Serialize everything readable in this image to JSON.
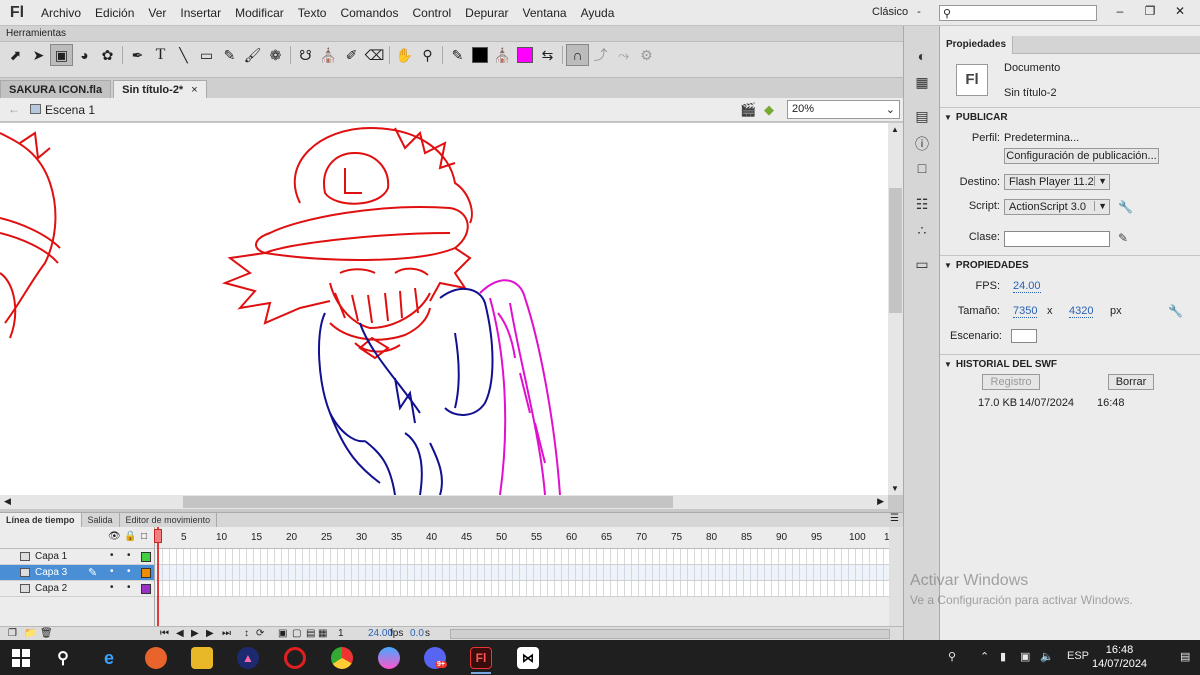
{
  "app": {
    "logo": "Fl"
  },
  "menu": [
    "Archivo",
    "Edición",
    "Ver",
    "Insertar",
    "Modificar",
    "Texto",
    "Comandos",
    "Control",
    "Depurar",
    "Ventana",
    "Ayuda"
  ],
  "workspace": {
    "label": "Clásico",
    "caret": "-"
  },
  "tools_panel": {
    "title": "Herramientas"
  },
  "colors": {
    "stroke": "#000000",
    "fill": "#ff00ff",
    "accent": "#4a8fd6",
    "playhead": "#e23a3a"
  },
  "document_tabs": [
    {
      "label": "SAKURA ICON.fla",
      "close": ""
    },
    {
      "label": "Sin título-2*",
      "close": "×"
    }
  ],
  "scene": {
    "label": "Escena 1",
    "zoom": "20%"
  },
  "timeline": {
    "tabs": [
      "Línea de tiempo",
      "Salida",
      "Editor de movimiento"
    ],
    "ruler": [
      "1",
      "5",
      "10",
      "15",
      "20",
      "25",
      "30",
      "35",
      "40",
      "45",
      "50",
      "55",
      "60",
      "65",
      "70",
      "75",
      "80",
      "85",
      "90",
      "95",
      "100",
      "1"
    ],
    "layers": [
      {
        "name": "Capa 1",
        "color": "#40d040",
        "selected": false
      },
      {
        "name": "Capa 3",
        "color": "#f08c00",
        "selected": true
      },
      {
        "name": "Capa 2",
        "color": "#9b30c8",
        "selected": false
      }
    ],
    "status": {
      "frame": "1",
      "fps": "24.00",
      "fps_unit": "fps",
      "seconds": "0.0",
      "seconds_unit": "s"
    }
  },
  "properties": {
    "tab": "Propiedades",
    "doc_icon": "Fl",
    "doc_type": "Documento",
    "doc_name": "Sin título-2",
    "publish_header": "PUBLICAR",
    "profile_label": "Perfil:",
    "profile_value": "Predetermina...",
    "publish_settings_button": "Configuración de publicación...",
    "target_label": "Destino:",
    "target_value": "Flash Player 11.2",
    "script_label": "Script:",
    "script_value": "ActionScript 3.0",
    "class_label": "Clase:",
    "class_value": "",
    "properties_header": "PROPIEDADES",
    "fps_label": "FPS:",
    "fps_value": "24.00",
    "size_label": "Tamaño:",
    "width": "7350",
    "x_sep": "x",
    "height": "4320",
    "unit": "px",
    "stage_label": "Escenario:",
    "stage_color": "#ffffff",
    "history_header": "HISTORIAL DEL SWF",
    "log_button": "Registro",
    "clear_button": "Borrar",
    "history_entry": {
      "size": "17.0 KB",
      "date": "14/07/2024",
      "time": "16:48"
    }
  },
  "activation": {
    "title": "Activar Windows",
    "subtitle": "Ve a Configuración para activar Windows."
  },
  "taskbar": {
    "lang": "ESP",
    "time": "16:48",
    "date": "14/07/2024",
    "badge": "9+"
  }
}
